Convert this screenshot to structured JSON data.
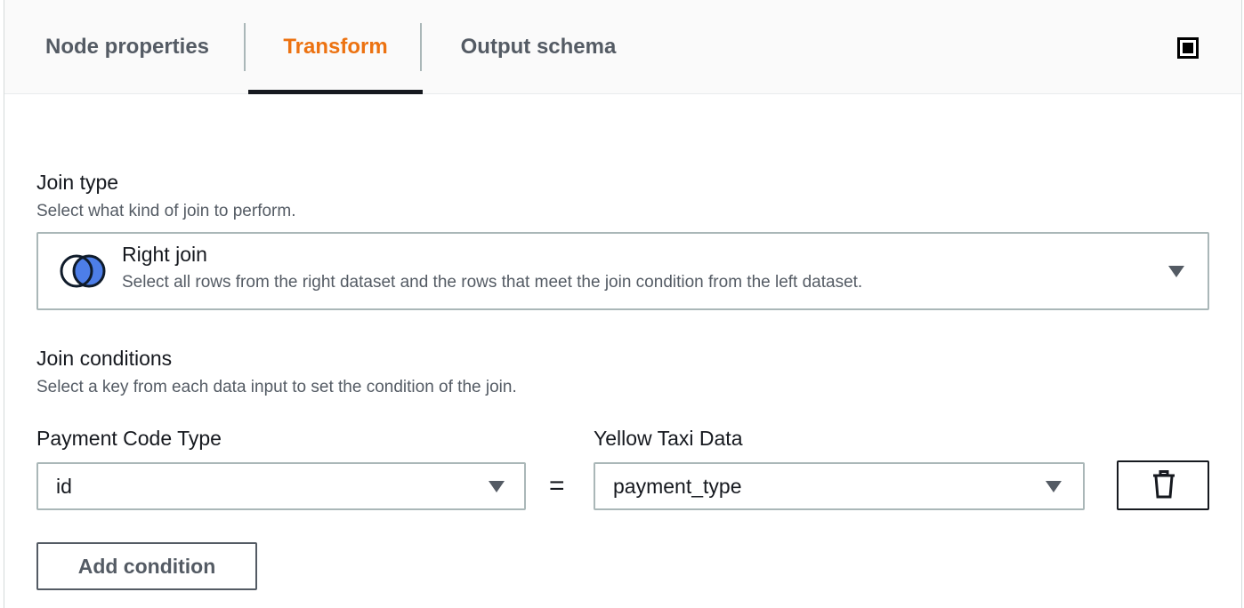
{
  "tabs": [
    {
      "label": "Node properties",
      "active": false
    },
    {
      "label": "Transform",
      "active": true
    },
    {
      "label": "Output schema",
      "active": false
    }
  ],
  "colors": {
    "active_tab": "#ec7211",
    "venn_fill": "#4d7ee8",
    "border": "#aab7b8"
  },
  "join_type": {
    "label": "Join type",
    "description": "Select what kind of join to perform.",
    "selected_title": "Right join",
    "selected_description": "Select all rows from the right dataset and the rows that meet the join condition from the left dataset.",
    "icon": "right-join-venn-icon"
  },
  "join_conditions": {
    "label": "Join conditions",
    "description": "Select a key from each data input to set the condition of the join.",
    "left_label": "Payment Code Type",
    "left_value": "id",
    "operator": "=",
    "right_label": "Yellow Taxi Data",
    "right_value": "payment_type",
    "delete_icon": "trash-icon",
    "add_button": "Add condition"
  }
}
